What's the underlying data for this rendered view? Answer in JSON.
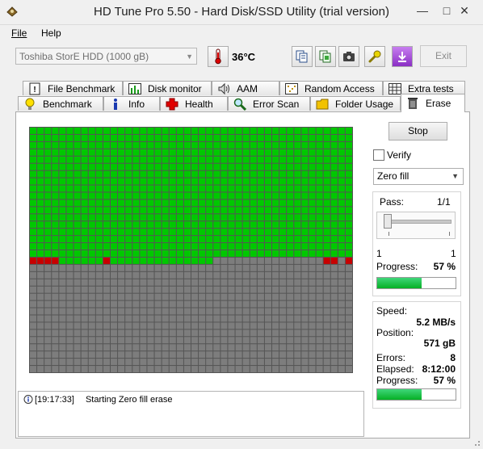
{
  "window": {
    "title": "HD Tune Pro 5.50 - Hard Disk/SSD Utility (trial version)"
  },
  "menu": {
    "file": "File",
    "help": "Help"
  },
  "toolbar": {
    "drive": "Toshiba StorE HDD (1000 gB)",
    "temperature": "36°C",
    "exit_label": "Exit"
  },
  "tabs_top": [
    {
      "label": "File Benchmark",
      "icon": "info-page-icon"
    },
    {
      "label": "Disk monitor",
      "icon": "chart-icon"
    },
    {
      "label": "AAM",
      "icon": "speaker-icon"
    },
    {
      "label": "Random Access",
      "icon": "scatter-icon"
    },
    {
      "label": "Extra tests",
      "icon": "grid-icon"
    }
  ],
  "tabs_bottom": [
    {
      "label": "Benchmark",
      "icon": "bulb-icon"
    },
    {
      "label": "Info",
      "icon": "info-icon"
    },
    {
      "label": "Health",
      "icon": "cross-icon"
    },
    {
      "label": "Error Scan",
      "icon": "magnifier-icon"
    },
    {
      "label": "Folder Usage",
      "icon": "folder-icon"
    },
    {
      "label": "Erase",
      "icon": "trash-icon"
    }
  ],
  "controls": {
    "stop_label": "Stop",
    "verify_label": "Verify",
    "verify_checked": false,
    "mode": "Zero fill"
  },
  "pass": {
    "label": "Pass:",
    "value": "1/1",
    "slider_min": "1",
    "slider_max": "1",
    "progress_label": "Progress:",
    "progress_value": "57 %",
    "progress_fraction": 0.57
  },
  "stats": {
    "speed_label": "Speed:",
    "speed_value": "5.2 MB/s",
    "position_label": "Position:",
    "position_value": "571 gB",
    "errors_label": "Errors:",
    "errors_value": "8",
    "elapsed_label": "Elapsed:",
    "elapsed_value": "8:12:00",
    "progress_label": "Progress:",
    "progress_value": "57 %",
    "progress_fraction": 0.57
  },
  "grid": {
    "cols": 44,
    "rows": 34,
    "done_rows_full": 18,
    "done_cols_partial_row": 25,
    "error_cells": [
      [
        18,
        0
      ],
      [
        18,
        1
      ],
      [
        18,
        2
      ],
      [
        18,
        3
      ],
      [
        18,
        10
      ],
      [
        18,
        40
      ],
      [
        18,
        41
      ],
      [
        18,
        43
      ]
    ],
    "colors": {
      "done": "#00c800",
      "pending": "#7d7d7d",
      "error": "#c80000",
      "line": "#555555"
    }
  },
  "log": [
    {
      "time": "[19:17:33]",
      "message": "Starting Zero fill erase"
    }
  ]
}
